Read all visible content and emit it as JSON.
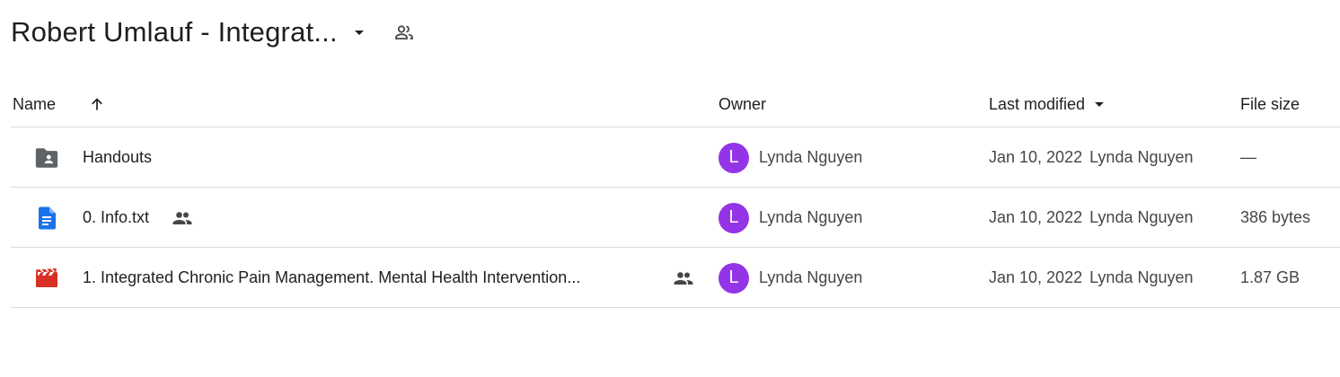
{
  "header": {
    "folder_title": "Robert Umlauf - Integrat...",
    "caret_icon": "arrow-drop-down-icon",
    "share_icon": "people-outline-icon"
  },
  "columns": {
    "name": "Name",
    "owner": "Owner",
    "last_modified": "Last modified",
    "file_size": "File size",
    "sort_icon": "arrow-upward-icon",
    "modified_sort_icon": "arrow-drop-down-icon"
  },
  "rows": [
    {
      "icon": "shared-folder-icon",
      "name": "Handouts",
      "shared": false,
      "owner_initial": "L",
      "owner": "Lynda Nguyen",
      "modified_date": "Jan 10, 2022",
      "modified_by": "Lynda Nguyen",
      "size": "—"
    },
    {
      "icon": "google-docs-icon",
      "name": "0. Info.txt",
      "shared": true,
      "owner_initial": "L",
      "owner": "Lynda Nguyen",
      "modified_date": "Jan 10, 2022",
      "modified_by": "Lynda Nguyen",
      "size": "386 bytes"
    },
    {
      "icon": "video-file-icon",
      "name": "1. Integrated Chronic Pain Management.  Mental Health Intervention...",
      "shared": true,
      "owner_initial": "L",
      "owner": "Lynda Nguyen",
      "modified_date": "Jan 10, 2022",
      "modified_by": "Lynda Nguyen",
      "size": "1.87 GB"
    }
  ],
  "colors": {
    "avatar": "#9334e6",
    "folder_icon": "#5f6368",
    "doc_icon": "#1a73e8",
    "video_icon": "#d93025",
    "divider": "#dadce0"
  }
}
